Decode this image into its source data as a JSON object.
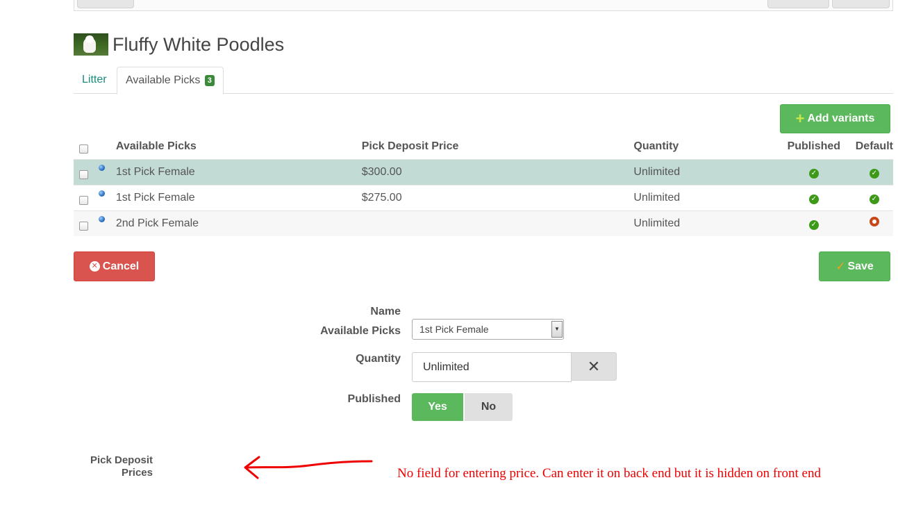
{
  "page": {
    "title": "Fluffy White Poodles"
  },
  "tabs": [
    {
      "label": "Litter"
    },
    {
      "label": "Available Picks",
      "badge": "3"
    }
  ],
  "toolbar": {
    "add_variants_label": "Add variants",
    "cancel_label": "Cancel",
    "save_label": "Save"
  },
  "table": {
    "headers": {
      "name": "Available Picks",
      "price": "Pick Deposit Price",
      "quantity": "Quantity",
      "published": "Published",
      "default": "Default"
    },
    "rows": [
      {
        "name": "1st Pick Female",
        "price": "$300.00",
        "quantity": "Unlimited",
        "published": true,
        "default": true
      },
      {
        "name": "1st Pick Female",
        "price": "$275.00",
        "quantity": "Unlimited",
        "published": true,
        "default": true
      },
      {
        "name": "2nd Pick Female",
        "price": "",
        "quantity": "Unlimited",
        "published": true,
        "default": false
      }
    ]
  },
  "form": {
    "name_label": "Name",
    "picks_label": "Available Picks",
    "picks_value": "1st Pick Female",
    "quantity_label": "Quantity",
    "quantity_value": "Unlimited",
    "published_label": "Published",
    "yes_label": "Yes",
    "no_label": "No",
    "price_label_line1": "Pick Deposit",
    "price_label_line2": "Prices"
  },
  "annotation": {
    "text": "No field for entering price.  Can enter it on back end but it is hidden on front end"
  },
  "colors": {
    "accent_green": "#5cb85c",
    "danger_red": "#d9534f",
    "active_row": "#c2dbd5",
    "annotation_red": "#ee0000"
  }
}
